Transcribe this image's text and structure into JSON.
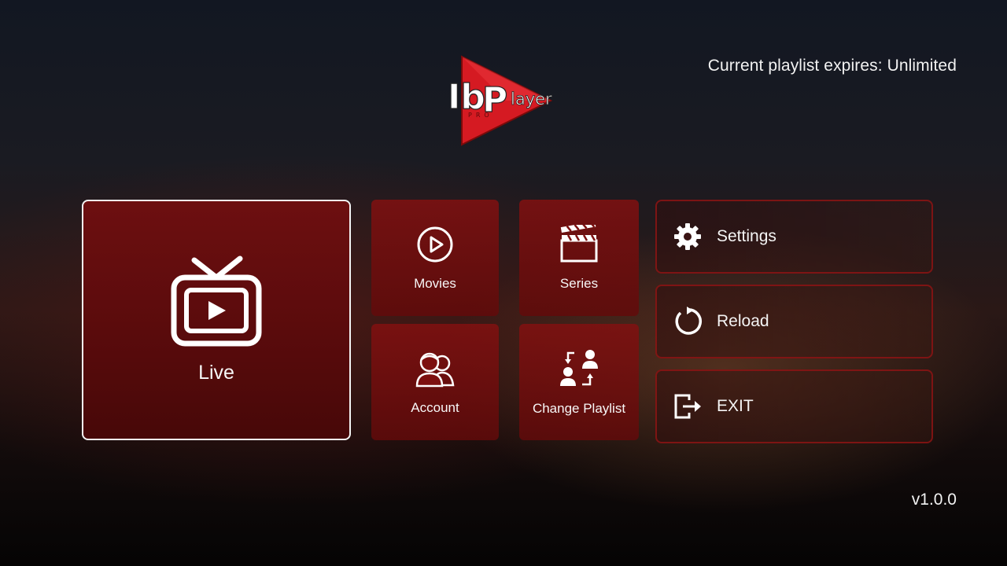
{
  "header": {
    "expires_text": "Current playlist expires: Unlimited"
  },
  "logo": {
    "text_ib": "Ib",
    "text_p": "P",
    "text_layer": "layer",
    "text_pro": "PRO",
    "icon": "play-triangle-logo",
    "accent_color": "#d51a22"
  },
  "tiles": {
    "live": {
      "label": "Live",
      "icon": "tv-icon"
    },
    "movies": {
      "label": "Movies",
      "icon": "play-circle-icon"
    },
    "series": {
      "label": "Series",
      "icon": "clapperboard-icon"
    },
    "account": {
      "label": "Account",
      "icon": "users-icon"
    },
    "playlist": {
      "label": "Change Playlist",
      "icon": "swap-users-icon"
    }
  },
  "side_menu": {
    "settings": {
      "label": "Settings",
      "icon": "gear-icon"
    },
    "reload": {
      "label": "Reload",
      "icon": "reload-icon"
    },
    "exit": {
      "label": "EXIT",
      "icon": "exit-icon"
    }
  },
  "footer": {
    "version": "v1.0.0"
  },
  "colors": {
    "tile_red": "#7d1010",
    "selected_border": "#f4f4f4",
    "side_border": "#8c1414"
  }
}
